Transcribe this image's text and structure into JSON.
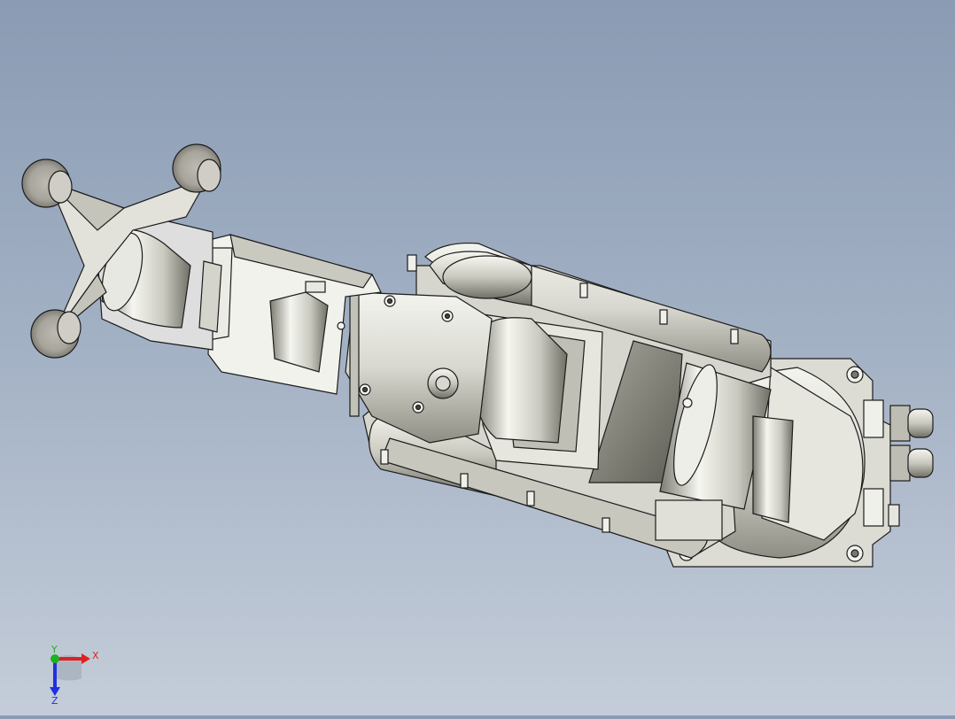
{
  "viewport": {
    "background_top": "#8a9bb3",
    "background_bottom": "#c4cdd9",
    "model_color": "#e4e4de",
    "edge_color": "#1c1c1c"
  },
  "triad": {
    "x_label": "X",
    "y_label": "Y",
    "z_label": "Z",
    "x_color": "#e02020",
    "y_color": "#20b020",
    "z_color": "#2030e0"
  }
}
